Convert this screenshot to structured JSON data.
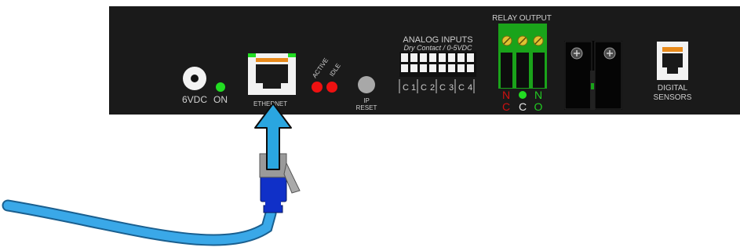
{
  "labels": {
    "power": "6VDC",
    "on": "ON",
    "ethernet": "ETHERNET",
    "active": "ACTIVE",
    "idle": "IDLE",
    "ip_reset_line1": "IP",
    "ip_reset_line2": "RESET",
    "analog_title": "ANALOG INPUTS",
    "analog_subtitle": "Dry Contact / 0-5VDC",
    "relay_title": "RELAY OUTPUT",
    "digital_line1": "DIGITAL",
    "digital_line2": "SENSORS"
  },
  "analog_channels": [
    {
      "c": "C",
      "n": "1"
    },
    {
      "c": "C",
      "n": "2"
    },
    {
      "c": "C",
      "n": "3"
    },
    {
      "c": "C",
      "n": "4"
    }
  ],
  "relay_terminals": [
    {
      "top": "N",
      "bottom": "C"
    },
    {
      "top": "",
      "bottom": "C"
    },
    {
      "top": "N",
      "bottom": "O"
    }
  ],
  "colors": {
    "panel": "#1a1a1a",
    "led_green": "#22dd22",
    "led_red": "#ee1111",
    "relay_green": "#1aa31a",
    "text_light": "#cfcfcf",
    "relay_nc": "#d01010",
    "relay_no": "#22cc22",
    "cable": "#3aa8e8",
    "arrow": "#2aa6e0",
    "plug_blue": "#1030c8",
    "plug_gray": "#9a9a9a"
  }
}
